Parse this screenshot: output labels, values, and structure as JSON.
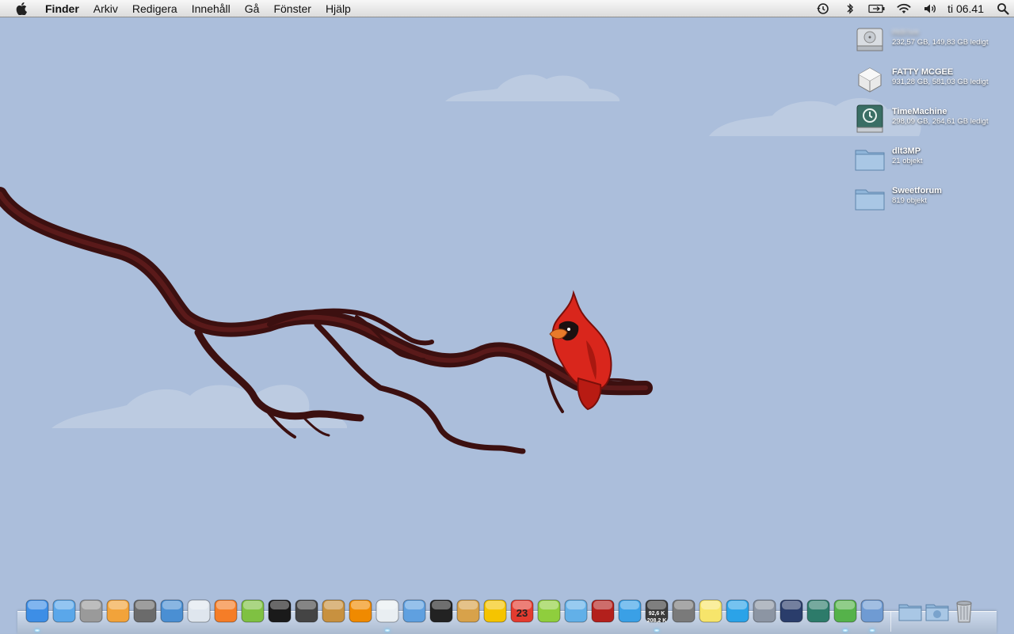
{
  "menubar": {
    "app_name": "Finder",
    "menus": [
      "Arkiv",
      "Redigera",
      "Innehåll",
      "Gå",
      "Fönster",
      "Hjälp"
    ],
    "status_icons": [
      "time-machine-icon",
      "bluetooth-icon",
      "battery-icon",
      "wifi-icon",
      "volume-icon"
    ],
    "clock": "ti 06.41"
  },
  "desktop_icons": [
    {
      "name": "Hdrive",
      "info": "232,57 GB, 149,83 GB ledigt",
      "icon": "hard-drive-icon"
    },
    {
      "name": "FATTY MCGEE",
      "info": "931,28 GB, 581,03 GB ledigt",
      "icon": "external-drive-icon"
    },
    {
      "name": "TimeMachine",
      "info": "298,09 GB, 264,61 GB ledigt",
      "icon": "time-machine-drive-icon"
    },
    {
      "name": "dlt3MP",
      "info": "21 objekt",
      "icon": "folder-icon"
    },
    {
      "name": "Sweetforum",
      "info": "819 objekt",
      "icon": "folder-icon"
    }
  ],
  "dock": {
    "apps": [
      {
        "name": "finder-icon",
        "running": true,
        "color": "#3d8ee6"
      },
      {
        "name": "ichat-icon",
        "running": false,
        "color": "#5aa7ea"
      },
      {
        "name": "calculator-icon",
        "running": false,
        "color": "#9a9a9a"
      },
      {
        "name": "audacity-icon",
        "running": false,
        "color": "#f2a33a"
      },
      {
        "name": "audio-midi-icon",
        "running": false,
        "color": "#6b6b6b"
      },
      {
        "name": "safari-icon",
        "running": false,
        "color": "#4a8fd3"
      },
      {
        "name": "flickr-uploader-icon",
        "running": false,
        "color": "#dfe6ee"
      },
      {
        "name": "rss-icon",
        "running": false,
        "color": "#f57d27"
      },
      {
        "name": "spotify-icon",
        "running": false,
        "color": "#7fc142"
      },
      {
        "name": "ableton-live-icon",
        "running": false,
        "color": "#1a1a1a"
      },
      {
        "name": "keyboard-icon",
        "running": false,
        "color": "#444"
      },
      {
        "name": "address-book-icon",
        "running": false,
        "color": "#c8913f"
      },
      {
        "name": "vlc-icon",
        "running": false,
        "color": "#f08a00"
      },
      {
        "name": "robot-icon",
        "running": true,
        "color": "#e9eef2"
      },
      {
        "name": "iphone-config-icon",
        "running": false,
        "color": "#5fa0e0"
      },
      {
        "name": "terminal-icon",
        "running": false,
        "color": "#222"
      },
      {
        "name": "preview-icon",
        "running": false,
        "color": "#d8a24a"
      },
      {
        "name": "magnet-icon",
        "running": false,
        "color": "#f5c400"
      },
      {
        "name": "ical-icon",
        "running": false,
        "color": "#e33b2f"
      },
      {
        "name": "clock-widget-icon",
        "running": false,
        "color": "#8fce3d"
      },
      {
        "name": "fish-icon",
        "running": false,
        "color": "#62b0e8"
      },
      {
        "name": "photo-booth-icon",
        "running": false,
        "color": "#b3201c"
      },
      {
        "name": "itunes-icon",
        "running": false,
        "color": "#3aa0e6"
      },
      {
        "name": "network-monitor-icon",
        "running": true,
        "color": "#3b3b3b"
      },
      {
        "name": "sync-icon",
        "running": false,
        "color": "#7a7a7a"
      },
      {
        "name": "stickies-icon",
        "running": false,
        "color": "#f7e56b"
      },
      {
        "name": "skype-icon",
        "running": false,
        "color": "#2ba3e8"
      },
      {
        "name": "utilities-icon",
        "running": false,
        "color": "#8c95a3"
      },
      {
        "name": "spaces-icon",
        "running": false,
        "color": "#2a3d6b"
      },
      {
        "name": "time-machine-app-icon",
        "running": false,
        "color": "#2d7b6a"
      },
      {
        "name": "x-app-icon",
        "running": true,
        "color": "#55b24a"
      },
      {
        "name": "iphoto-icon",
        "running": true,
        "color": "#6f9bd3"
      }
    ],
    "network_readout": [
      "92,6 K",
      "208,2 K"
    ],
    "calendar_day": "23",
    "stacks": [
      "applications-folder-icon",
      "downloads-folder-icon",
      "trash-icon"
    ]
  }
}
